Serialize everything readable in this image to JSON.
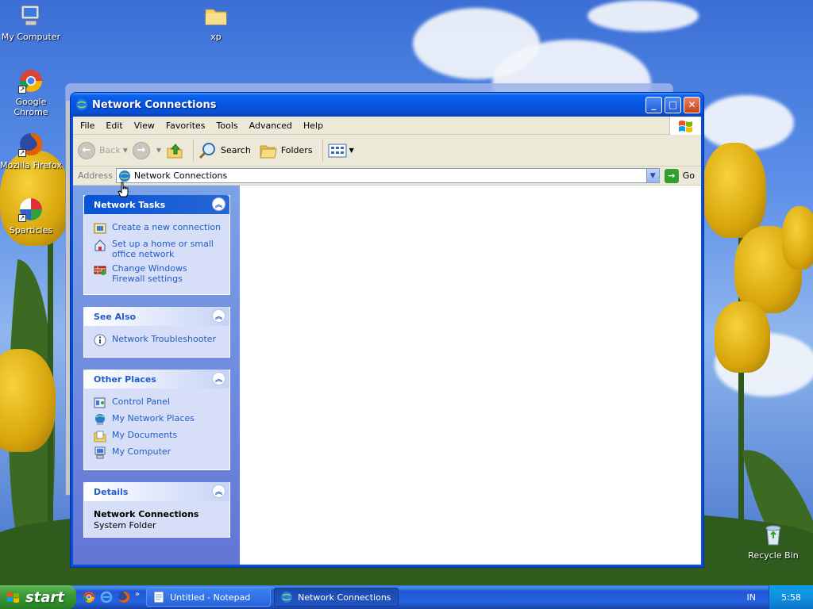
{
  "desktop": {
    "icons": [
      {
        "label": "My Computer",
        "icon": "my-computer-icon"
      },
      {
        "label": "xp",
        "icon": "folder-icon"
      },
      {
        "label": "Google Chrome",
        "icon": "chrome-icon"
      },
      {
        "label": "Mozilla Firefox",
        "icon": "firefox-icon"
      },
      {
        "label": "Sparticles",
        "icon": "sparticles-icon"
      },
      {
        "label": "Recycle Bin",
        "icon": "recycle-bin-icon"
      }
    ]
  },
  "window": {
    "title": "Network Connections",
    "menu": [
      "File",
      "Edit",
      "View",
      "Favorites",
      "Tools",
      "Advanced",
      "Help"
    ],
    "toolbar": {
      "back": "Back",
      "search": "Search",
      "folders": "Folders"
    },
    "address": {
      "label": "Address",
      "value": "Network Connections",
      "go": "Go"
    },
    "taskpane": {
      "network_tasks": {
        "title": "Network Tasks",
        "items": [
          "Create a new connection",
          "Set up a home or small office network",
          "Change Windows Firewall settings"
        ]
      },
      "see_also": {
        "title": "See Also",
        "items": [
          "Network Troubleshooter"
        ]
      },
      "other_places": {
        "title": "Other Places",
        "items": [
          "Control Panel",
          "My Network Places",
          "My Documents",
          "My Computer"
        ]
      },
      "details": {
        "title": "Details",
        "name": "Network Connections",
        "type": "System Folder"
      }
    }
  },
  "taskbar": {
    "start": "start",
    "tasks": [
      {
        "label": "Untitled - Notepad",
        "active": false
      },
      {
        "label": "Network Connections",
        "active": true
      }
    ],
    "language": "IN",
    "clock": "5:58"
  },
  "colors": {
    "link": "#215dc6",
    "titlebar": "#0553e1",
    "taskpane": "#7ba2e7"
  }
}
